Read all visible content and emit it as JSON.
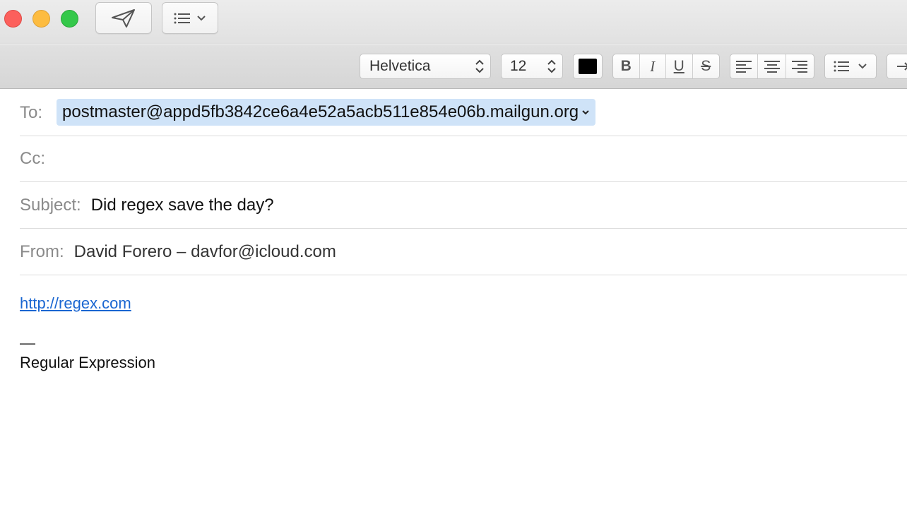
{
  "window": {
    "buttons": {
      "close": "close",
      "minimize": "minimize",
      "zoom": "zoom"
    }
  },
  "toolbar": {
    "send_icon": "paper-plane-icon",
    "header_fields_icon": "list-icon"
  },
  "format_bar": {
    "font": "Helvetica",
    "size": "12",
    "text_color": "#000000",
    "styles": [
      "B",
      "I",
      "U",
      "S"
    ],
    "alignments": [
      "align-left",
      "align-center",
      "align-right"
    ],
    "list_icon": "bulleted-list-icon"
  },
  "compose": {
    "to_label": "To:",
    "to_value": "postmaster@appd5fb3842ce6a4e52a5acb511e854e06b.mailgun.org",
    "cc_label": "Cc:",
    "subject_label": "Subject:",
    "subject_value": "Did regex save the day?",
    "from_label": "From:",
    "from_value": "David Forero – davfor@icloud.com"
  },
  "body": {
    "link": "http://regex.com",
    "separator": "—",
    "signature": "Regular Expression"
  },
  "colors": {
    "recipient_highlight": "#cfe3f8",
    "link": "#1a66d1"
  }
}
